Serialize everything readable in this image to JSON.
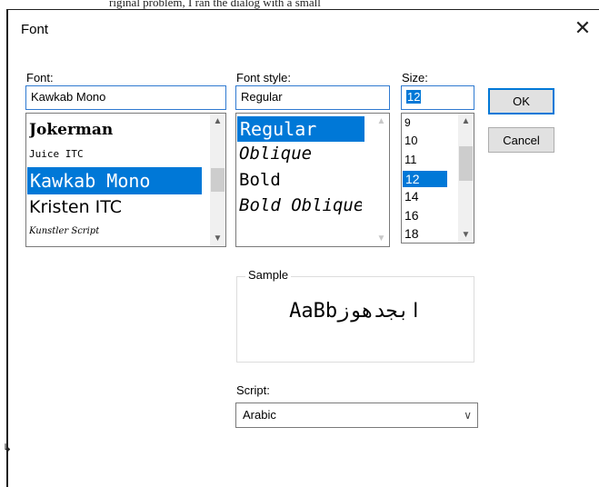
{
  "window": {
    "title": "Font",
    "close_glyph": "✕"
  },
  "stray_top_text": "riginal problem, I ran the dialog with a small",
  "stray_left_text": "↳",
  "font": {
    "label": "Font:",
    "value": "Kawkab Mono",
    "items": [
      "Jokerman",
      "Juice ITC",
      "Kawkab Mono",
      "Kristen ITC",
      "Kunstler Script"
    ],
    "selected_index": 2
  },
  "font_style": {
    "label": "Font style:",
    "value": "Regular",
    "items": [
      "Regular",
      "Oblique",
      "Bold",
      "Bold Oblique"
    ],
    "selected_index": 0
  },
  "size": {
    "label": "Size:",
    "value": "12",
    "items": [
      "9",
      "10",
      "11",
      "12",
      "14",
      "16",
      "18"
    ],
    "selected_index": 3
  },
  "buttons": {
    "ok": "OK",
    "cancel": "Cancel"
  },
  "sample": {
    "label": "Sample",
    "text": "AaBbابجدهوز"
  },
  "script": {
    "label": "Script:",
    "value": "Arabic"
  },
  "icons": {
    "scroll_up": "chevron-up-icon",
    "scroll_down": "chevron-down-icon",
    "close": "close-icon",
    "dropdown": "chevron-down-icon"
  },
  "colors": {
    "selection": "#0078d7",
    "button_face": "#e1e1e1",
    "default_button_border": "#0078d7"
  }
}
